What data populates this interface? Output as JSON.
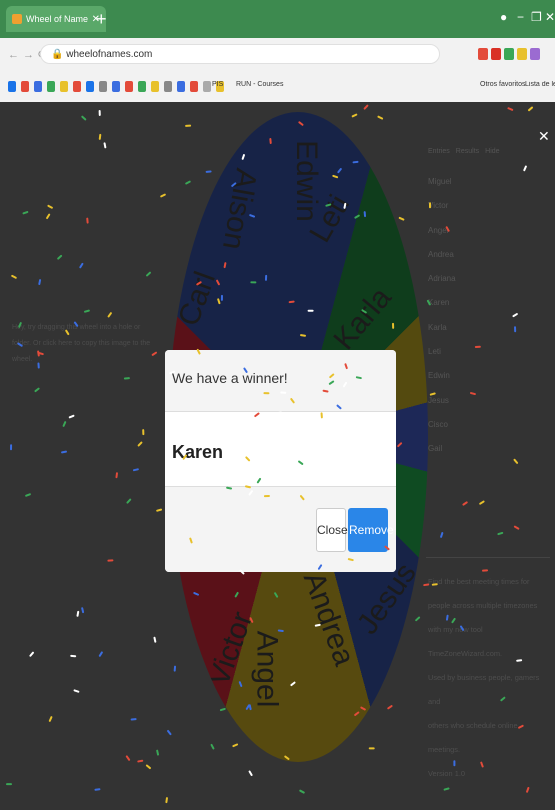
{
  "browser": {
    "tab_title": "Wheel of Names | Random",
    "tab_close": "✕",
    "new_tab": "+",
    "url": "wheelofnames.com",
    "window_controls": [
      "−",
      "❐",
      "✕"
    ]
  },
  "bookmarks": {
    "items": [
      "PIS",
      "RUN - Courses"
    ],
    "right": [
      "Otros favoritos",
      "Lista de lectura"
    ]
  },
  "wheel": {
    "entries": [
      "Edwin",
      "Leti",
      "Karla",
      "Carl",
      "Alison",
      "Andrea",
      "Angel",
      "Victor",
      "Jesus",
      "Carl"
    ]
  },
  "sidebar": {
    "tabs": [
      "Entries",
      "Results",
      "Hide"
    ],
    "names": [
      "Miguel",
      "Victor",
      "Angel",
      "Andrea",
      "Adriana",
      "Karen",
      "Karla",
      "Leti",
      "Edwin",
      "Jesus",
      "Cisco",
      "Gail"
    ],
    "promo": [
      "Find the best meeting times for",
      "people across multiple timezones",
      "with my new tool TimeZoneWizard.com.",
      "Used by business people, gamers and",
      "others who schedule online meetings.",
      "Version 1.0"
    ]
  },
  "left_message": "Hey, try dragging this wheel into a hole or folder. Or click here to copy this image to the wheel.",
  "modal": {
    "title": "We have a winner!",
    "winner": "Karen",
    "close_label": "Close",
    "remove_label": "Remove"
  },
  "colors": {
    "accent": "#2a86e8",
    "tabbar": "#3d8a4f",
    "confetti": [
      "#e8c12c",
      "#e34b3a",
      "#3b6de0",
      "#3aa757",
      "#ffffff"
    ]
  }
}
